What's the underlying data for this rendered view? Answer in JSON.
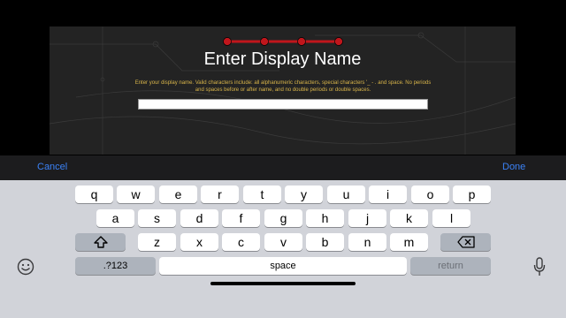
{
  "dialog": {
    "title": "Enter Display Name",
    "description": "Enter your display name. Valid characters include: all alphanumeric characters, special characters '_ - . and space. No periods and spaces before or after name, and no double periods or double spaces.",
    "input_value": ""
  },
  "accessory_bar": {
    "cancel_label": "Cancel",
    "done_label": "Done"
  },
  "keyboard": {
    "row1": [
      "q",
      "w",
      "e",
      "r",
      "t",
      "y",
      "u",
      "i",
      "o",
      "p"
    ],
    "row2": [
      "a",
      "s",
      "d",
      "f",
      "g",
      "h",
      "j",
      "k",
      "l"
    ],
    "row3": [
      "z",
      "x",
      "c",
      "v",
      "b",
      "n",
      "m"
    ],
    "numbers_label": ".?123",
    "space_label": "space",
    "return_label": "return"
  },
  "colors": {
    "accent": "#3b82f6",
    "progress": "#c0161c",
    "description": "#d9b54a"
  },
  "icons": [
    "shift-icon",
    "backspace-icon",
    "emoji-icon",
    "microphone-icon"
  ]
}
